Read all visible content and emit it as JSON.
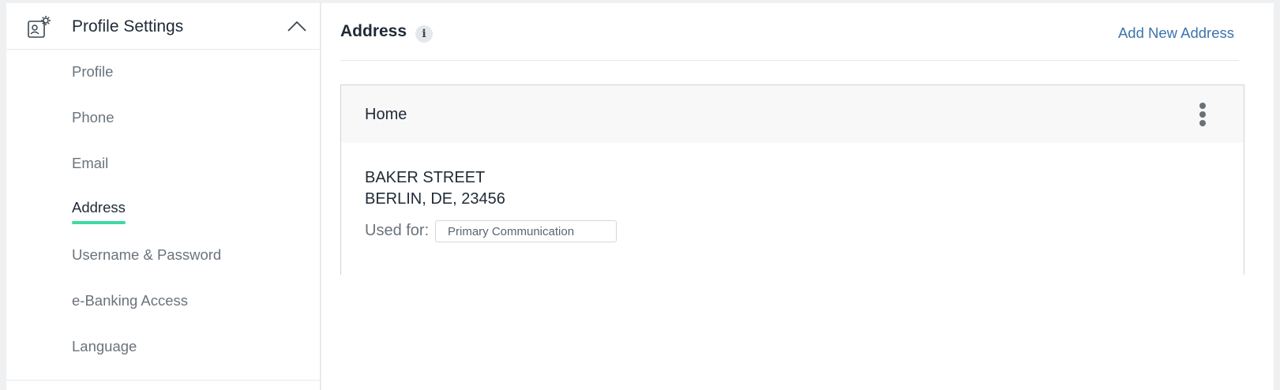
{
  "sidebar": {
    "title": "Profile Settings",
    "items": [
      {
        "label": "Profile"
      },
      {
        "label": "Phone"
      },
      {
        "label": "Email"
      },
      {
        "label": "Address"
      },
      {
        "label": "Username & Password"
      },
      {
        "label": "e-Banking Access"
      },
      {
        "label": "Language"
      }
    ],
    "active": "Address"
  },
  "main": {
    "title": "Address",
    "add_link": "Add New Address",
    "card": {
      "title": "Home",
      "line1": "BAKER STREET",
      "line2": "BERLIN, DE, 23456",
      "used_for_label": "Used for:",
      "used_for_tag": "Primary Communication"
    }
  },
  "colors": {
    "accent": "#3ed9a3",
    "link": "#3d73ad"
  },
  "icons": [
    "profile-settings-icon",
    "chevron-up-icon",
    "info-icon",
    "kebab-menu-icon"
  ]
}
